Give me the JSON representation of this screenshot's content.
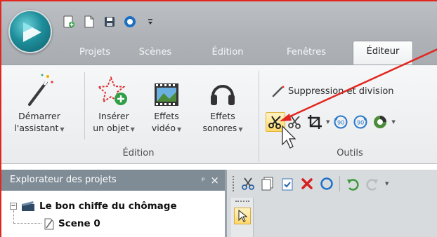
{
  "quick_access": {
    "icons": [
      "new-project-icon",
      "new-document-icon",
      "save-icon",
      "preview-icon",
      "customize-dropdown-icon"
    ]
  },
  "tabs": [
    {
      "label": "Projets",
      "active": false
    },
    {
      "label": "Scènes",
      "active": false
    },
    {
      "label": "Édition",
      "active": false
    },
    {
      "label": "Fenêtres",
      "active": false
    },
    {
      "label": "Éditeur",
      "active": true
    }
  ],
  "ribbon": {
    "edition_group": {
      "label": "Édition",
      "buttons": [
        {
          "line1": "Démarrer",
          "line2": "l'assistant",
          "icon": "magic-wand-icon"
        },
        {
          "line1": "Insérer",
          "line2": "un objet",
          "icon": "insert-object-icon"
        },
        {
          "line1": "Effets",
          "line2": "vidéo",
          "icon": "film-icon"
        },
        {
          "line1": "Effets",
          "line2": "sonores",
          "icon": "headphones-icon"
        }
      ]
    },
    "outils_group": {
      "label": "Outils",
      "suppression_label": "Suppression et division",
      "tool_icons": [
        "split-scissors-icon",
        "cut-scissors-icon",
        "crop-icon",
        "rotate-90-left-icon",
        "rotate-90-right-icon",
        "color-tool-icon"
      ]
    }
  },
  "project_explorer": {
    "title": "Explorateur des projets",
    "pin": "ᵖ",
    "close": "×",
    "project_name": "Le bon chiffe du chômage",
    "scene_name": "Scene 0"
  },
  "colors": {
    "highlight_border": "#e2261f",
    "panel_header": "#7f8c96",
    "active_tool": "#ffd86b"
  }
}
